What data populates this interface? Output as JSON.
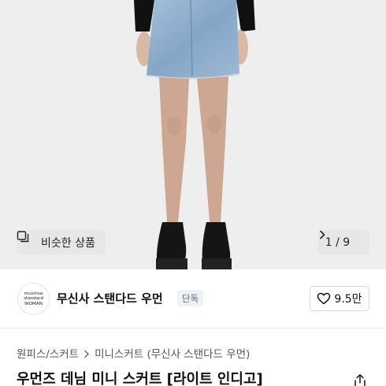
{
  "gallery": {
    "similar_label": "비슷한 상품",
    "current": "1",
    "total": "9",
    "pager_text": "1 / 9",
    "background": "#eeeeef"
  },
  "brand": {
    "logo_lines": [
      "musinsa",
      "standard",
      "WOMAN"
    ],
    "name": "무신사 스탠다드 우먼",
    "badge": "단독",
    "likes": "9.5만"
  },
  "breadcrumb": {
    "items": [
      "원피스/스커트",
      "미니스커트 (무신사 스탠다드 우먼)"
    ]
  },
  "product": {
    "title": "우먼즈 데님 미니 스커트 [라이트 인디고]"
  },
  "icons": {
    "similar": "similar-items-icon",
    "pager_next": "chevron-right-icon",
    "like": "heart-icon",
    "breadcrumb_sep": "chevron-right-icon",
    "share": "share-icon"
  }
}
